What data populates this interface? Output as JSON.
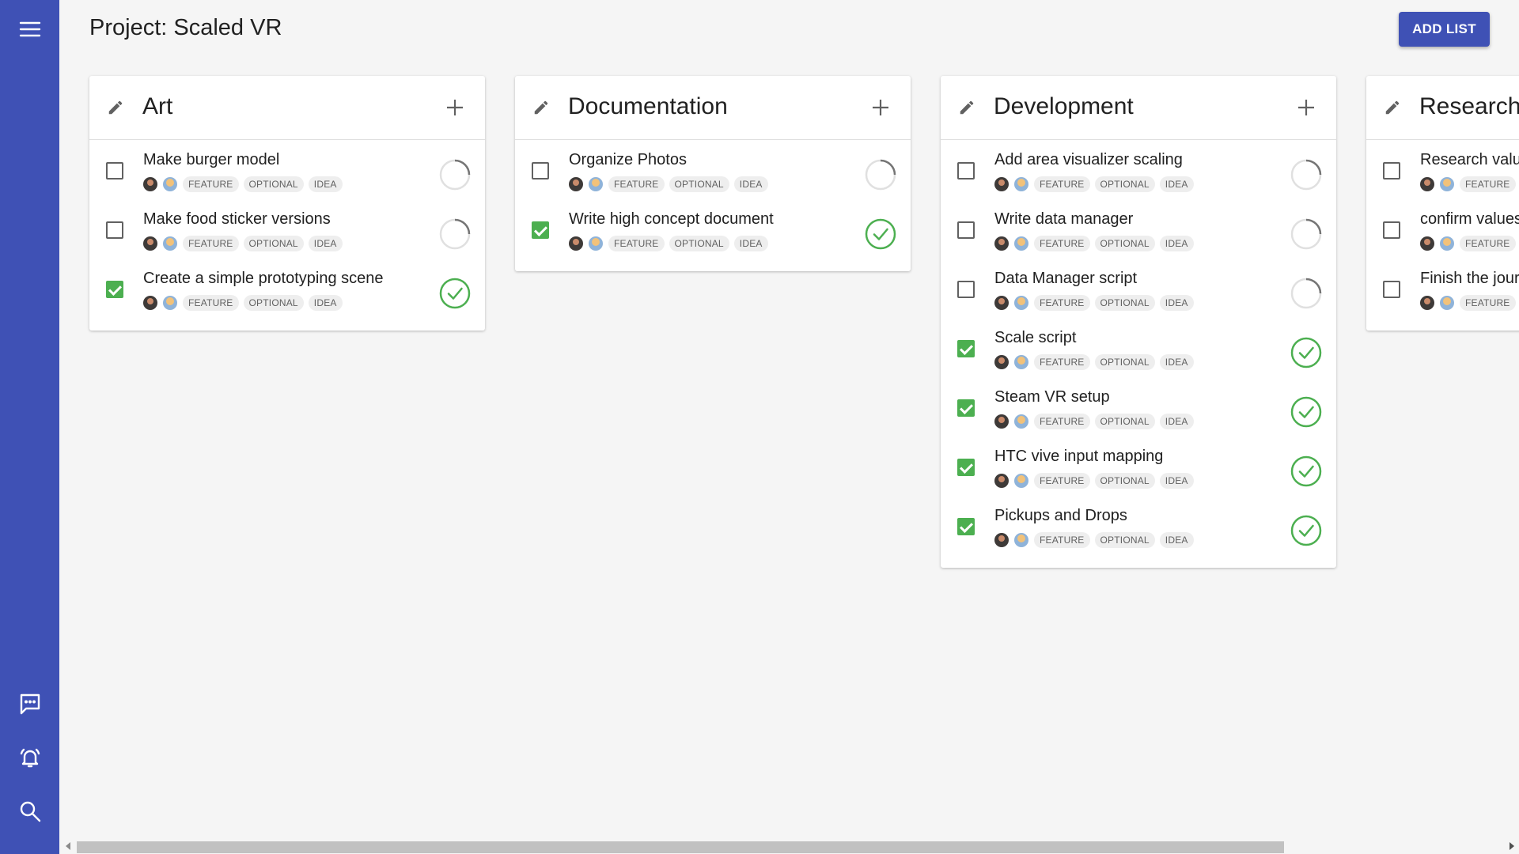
{
  "sidebar": {
    "menu_icon": "menu-icon",
    "chat_icon": "chat-icon",
    "notifications_icon": "bell-icon",
    "search_icon": "search-icon"
  },
  "header": {
    "title": "Project: Scaled VR",
    "add_list_label": "ADD LIST"
  },
  "colors": {
    "primary": "#3f51b5",
    "done": "#4caf50"
  },
  "lists": [
    {
      "title": "Art",
      "tasks": [
        {
          "title": "Make burger model",
          "done": false,
          "tags": [
            "FEATURE",
            "OPTIONAL",
            "IDEA"
          ]
        },
        {
          "title": "Make food sticker versions",
          "done": false,
          "tags": [
            "FEATURE",
            "OPTIONAL",
            "IDEA"
          ]
        },
        {
          "title": "Create a simple prototyping scene",
          "done": true,
          "tags": [
            "FEATURE",
            "OPTIONAL",
            "IDEA"
          ]
        }
      ]
    },
    {
      "title": "Documentation",
      "tasks": [
        {
          "title": "Organize Photos",
          "done": false,
          "tags": [
            "FEATURE",
            "OPTIONAL",
            "IDEA"
          ]
        },
        {
          "title": "Write high concept document",
          "done": true,
          "tags": [
            "FEATURE",
            "OPTIONAL",
            "IDEA"
          ]
        }
      ]
    },
    {
      "title": "Development",
      "tasks": [
        {
          "title": "Add area visualizer scaling",
          "done": false,
          "tags": [
            "FEATURE",
            "OPTIONAL",
            "IDEA"
          ]
        },
        {
          "title": "Write data manager",
          "done": false,
          "tags": [
            "FEATURE",
            "OPTIONAL",
            "IDEA"
          ]
        },
        {
          "title": "Data Manager script",
          "done": false,
          "tags": [
            "FEATURE",
            "OPTIONAL",
            "IDEA"
          ]
        },
        {
          "title": "Scale script",
          "done": true,
          "tags": [
            "FEATURE",
            "OPTIONAL",
            "IDEA"
          ]
        },
        {
          "title": "Steam VR setup",
          "done": true,
          "tags": [
            "FEATURE",
            "OPTIONAL",
            "IDEA"
          ]
        },
        {
          "title": "HTC vive input mapping",
          "done": true,
          "tags": [
            "FEATURE",
            "OPTIONAL",
            "IDEA"
          ]
        },
        {
          "title": "Pickups and Drops",
          "done": true,
          "tags": [
            "FEATURE",
            "OPTIONAL",
            "IDEA"
          ]
        }
      ]
    },
    {
      "title": "Research",
      "tasks": [
        {
          "title": "Research valu",
          "done": false,
          "tags": [
            "FEATURE"
          ]
        },
        {
          "title": "confirm values",
          "done": false,
          "tags": [
            "FEATURE"
          ]
        },
        {
          "title": "Finish the jour",
          "done": false,
          "tags": [
            "FEATURE"
          ]
        }
      ]
    }
  ]
}
